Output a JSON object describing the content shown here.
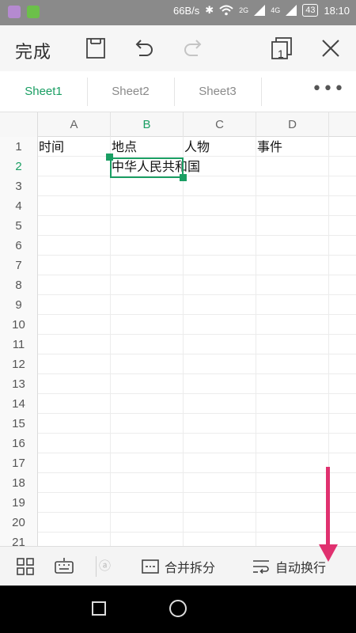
{
  "status_bar": {
    "net_speed": "66B/s",
    "sig1": "2G",
    "sig2": "4G",
    "battery": "43",
    "time": "18:10"
  },
  "toolbar": {
    "done_label": "完成",
    "icons": [
      "save-icon",
      "undo-icon",
      "redo-icon",
      "window-switch-icon",
      "close-icon"
    ],
    "window_count": "1"
  },
  "tabs": {
    "items": [
      {
        "label": "Sheet1",
        "active": true
      },
      {
        "label": "Sheet2",
        "active": false
      },
      {
        "label": "Sheet3",
        "active": false
      }
    ],
    "more_label": "•••"
  },
  "grid": {
    "columns": [
      "A",
      "B",
      "C",
      "D"
    ],
    "active_column": "B",
    "rows": [
      "1",
      "2",
      "3",
      "4",
      "5",
      "6",
      "7",
      "8",
      "9",
      "10",
      "11",
      "12",
      "13",
      "14",
      "15",
      "16",
      "17",
      "18",
      "19",
      "20",
      "21"
    ],
    "active_row": "2",
    "cells": {
      "A1": "时间",
      "B1": "地点",
      "C1": "人物",
      "D1": "事件",
      "B2": "中华人民共和国"
    }
  },
  "bottom_bar": {
    "merge_label": "合并拆分",
    "wrap_label": "自动换行",
    "icons": [
      "grid-menu-icon",
      "keyboard-icon",
      "merge-split-icon",
      "wrap-text-icon"
    ]
  },
  "colors": {
    "accent": "#1a9e63",
    "arrow": "#e0316f"
  }
}
